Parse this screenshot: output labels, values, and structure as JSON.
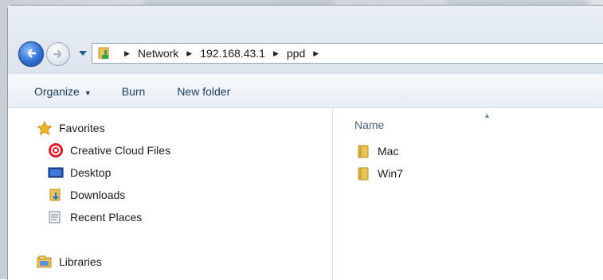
{
  "address_bar": {
    "segments": [
      "Network",
      "192.168.43.1",
      "ppd"
    ]
  },
  "command_bar": {
    "organize": "Organize",
    "burn": "Burn",
    "new_folder": "New folder"
  },
  "nav_pane": {
    "favorites": "Favorites",
    "items": [
      "Creative Cloud Files",
      "Desktop",
      "Downloads",
      "Recent Places"
    ],
    "libraries": "Libraries"
  },
  "file_list": {
    "column_name": "Name",
    "items": [
      "Mac",
      "Win7"
    ]
  },
  "colors": {
    "accent": "#2e6fd0",
    "folder": "#e8c25a"
  }
}
